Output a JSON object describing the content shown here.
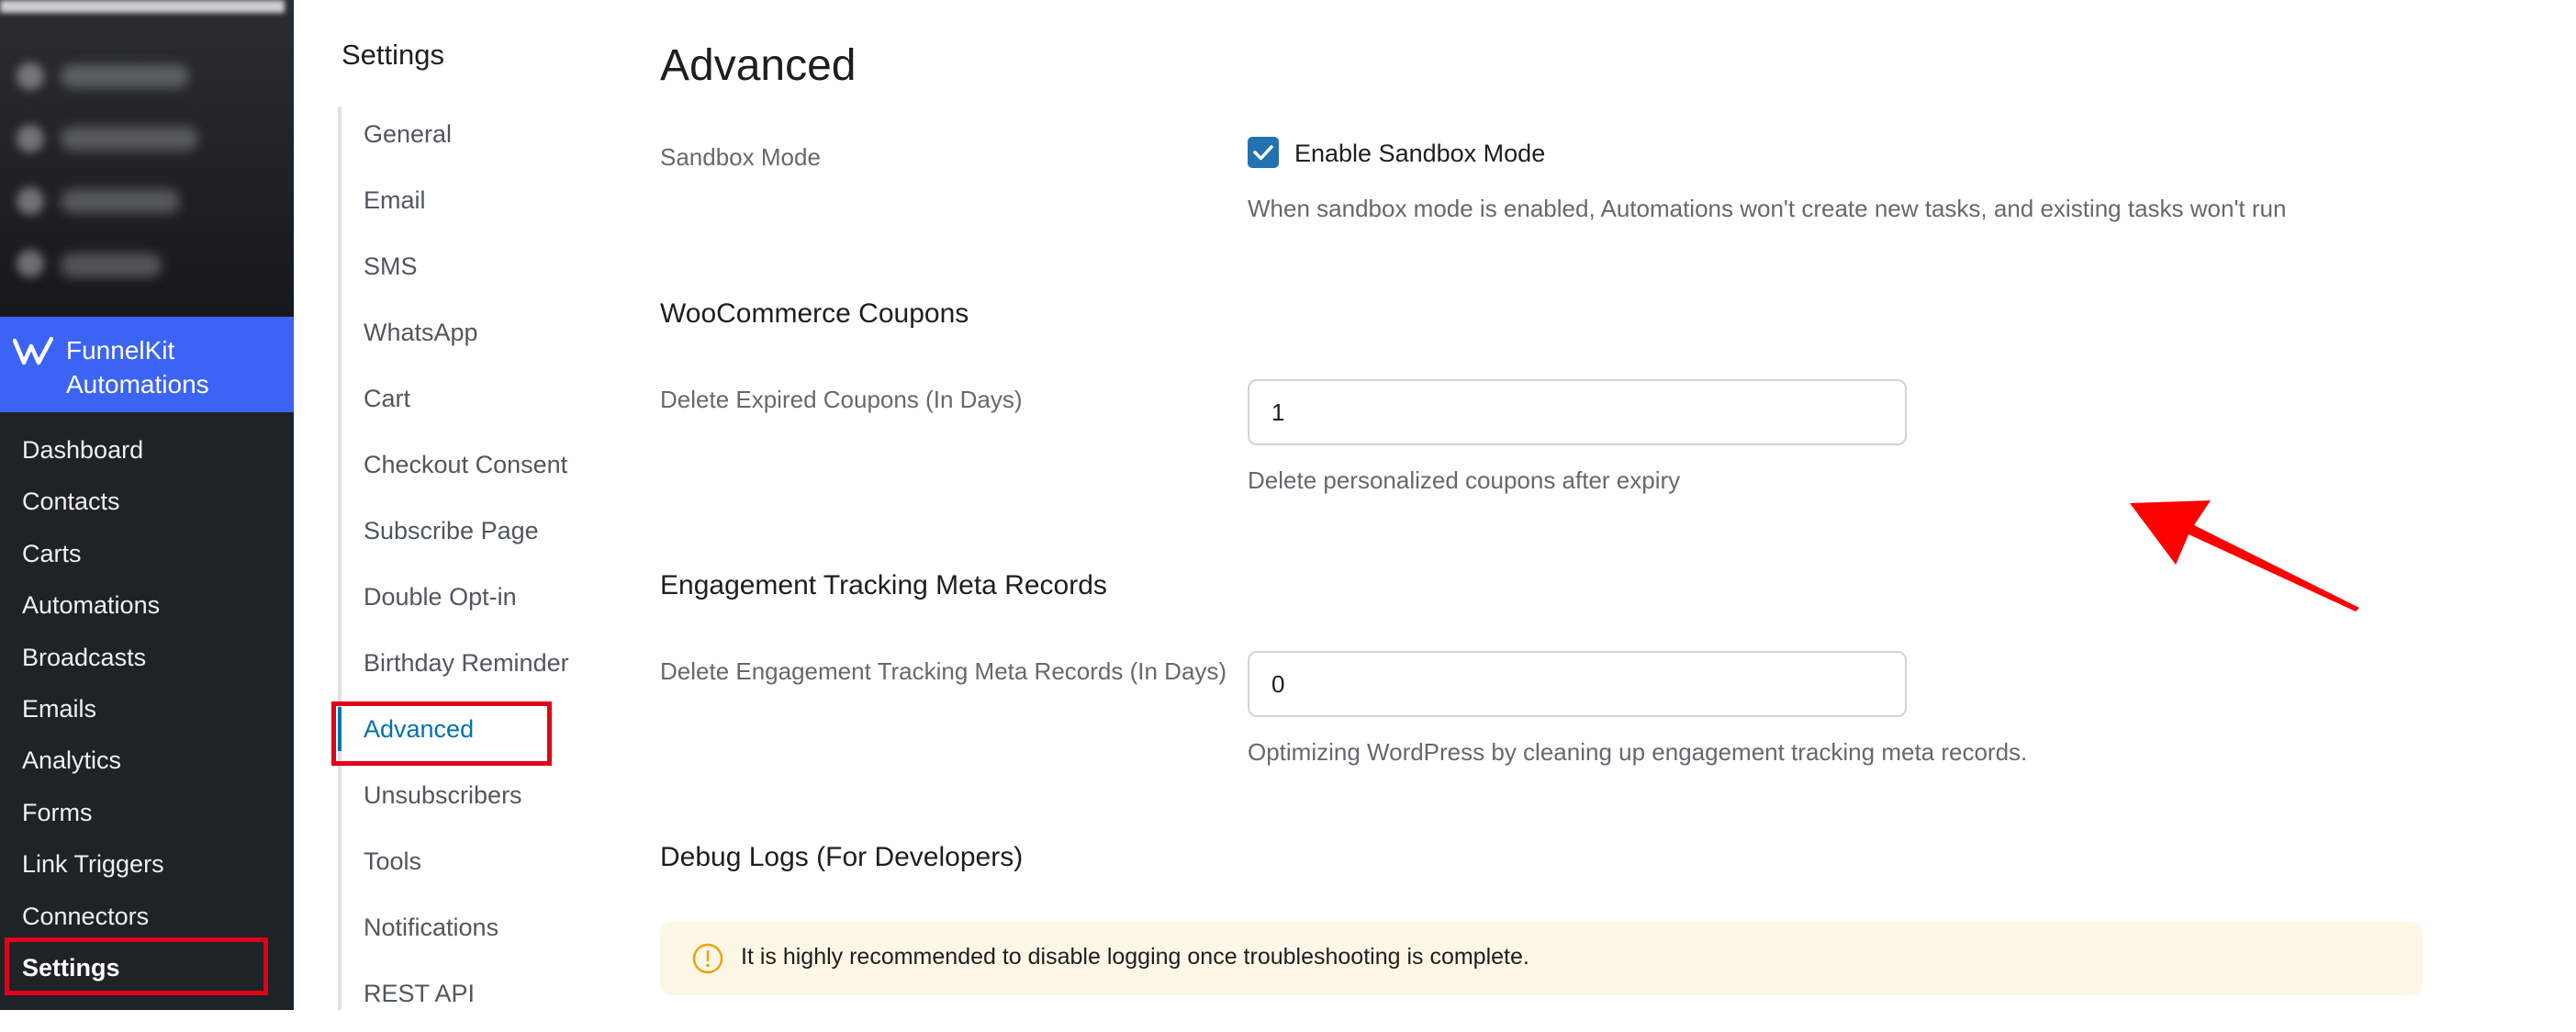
{
  "admin_sidebar": {
    "brand": "FunnelKit Automations",
    "brand_color": "#3c64f4",
    "items": [
      {
        "label": "Dashboard"
      },
      {
        "label": "Contacts"
      },
      {
        "label": "Carts"
      },
      {
        "label": "Automations"
      },
      {
        "label": "Broadcasts"
      },
      {
        "label": "Emails"
      },
      {
        "label": "Analytics"
      },
      {
        "label": "Forms"
      },
      {
        "label": "Link Triggers"
      },
      {
        "label": "Connectors"
      },
      {
        "label": "Settings"
      }
    ],
    "current": "Settings"
  },
  "settings_nav": {
    "title": "Settings",
    "items": [
      {
        "label": "General"
      },
      {
        "label": "Email"
      },
      {
        "label": "SMS"
      },
      {
        "label": "WhatsApp"
      },
      {
        "label": "Cart"
      },
      {
        "label": "Checkout Consent"
      },
      {
        "label": "Subscribe Page"
      },
      {
        "label": "Double Opt-in"
      },
      {
        "label": "Birthday Reminder"
      },
      {
        "label": "Advanced"
      },
      {
        "label": "Unsubscribers"
      },
      {
        "label": "Tools"
      },
      {
        "label": "Notifications"
      },
      {
        "label": "REST API"
      }
    ],
    "active": "Advanced",
    "active_color": "#0073aa"
  },
  "main": {
    "title": "Advanced",
    "sandbox": {
      "label": "Sandbox Mode",
      "checkbox_label": "Enable Sandbox Mode",
      "checked": true,
      "help": "When sandbox mode is enabled, Automations won't create new tasks, and existing tasks won't run"
    },
    "coupons": {
      "heading": "WooCommerce Coupons",
      "label": "Delete Expired Coupons (In Days)",
      "value": "1",
      "help": "Delete personalized coupons after expiry"
    },
    "engagement": {
      "heading": "Engagement Tracking Meta Records",
      "label": "Delete Engagement Tracking Meta Records (In Days)",
      "value": "0",
      "help": "Optimizing WordPress by cleaning up engagement tracking meta records."
    },
    "debug": {
      "heading": "Debug Logs (For Developers)",
      "notice": "It is highly recommended to disable logging once troubleshooting is complete."
    }
  },
  "annotation_color": "#e1001a",
  "icons": [
    "funnelkit-logo-icon",
    "checkmark-icon",
    "info-icon",
    "red-arrow-annotation"
  ]
}
